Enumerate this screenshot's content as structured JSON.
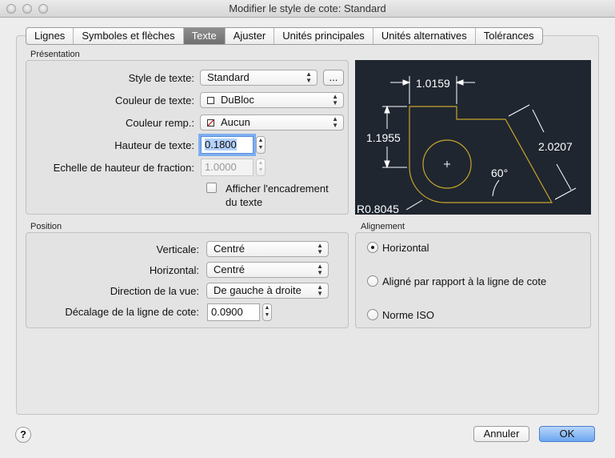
{
  "window": {
    "title": "Modifier le style de cote: Standard"
  },
  "tabs": [
    {
      "label": "Lignes"
    },
    {
      "label": "Symboles et flèches"
    },
    {
      "label": "Texte"
    },
    {
      "label": "Ajuster"
    },
    {
      "label": "Unités principales"
    },
    {
      "label": "Unités alternatives"
    },
    {
      "label": "Tolérances"
    }
  ],
  "active_tab": "Texte",
  "presentation": {
    "title": "Présentation",
    "text_style_label": "Style de texte:",
    "text_style_value": "Standard",
    "browse_label": "...",
    "text_color_label": "Couleur de texte:",
    "text_color_value": "DuBloc",
    "fill_color_label": "Couleur remp.:",
    "fill_color_value": "Aucun",
    "text_height_label": "Hauteur de texte:",
    "text_height_value": "0.1800",
    "fraction_scale_label": "Echelle de hauteur de fraction:",
    "fraction_scale_value": "1.0000",
    "frame_label_line1": "Afficher l'encadrement",
    "frame_label_line2": "du texte"
  },
  "preview": {
    "dim_top": "1.0159",
    "dim_left": "1.1955",
    "dim_diag": "2.0207",
    "angle": "60°",
    "radius": "R0.8045",
    "colors": {
      "background": "#1f2630",
      "geometry": "#c8a52a",
      "dimension": "#ffffff"
    }
  },
  "position": {
    "title": "Position",
    "vertical_label": "Verticale:",
    "vertical_value": "Centré",
    "horizontal_label": "Horizontal:",
    "horizontal_value": "Centré",
    "view_direction_label": "Direction de la vue:",
    "view_direction_value": "De gauche à droite",
    "offset_label": "Décalage de la ligne de cote:",
    "offset_value": "0.0900"
  },
  "alignment": {
    "title": "Alignement",
    "options": [
      {
        "label": "Horizontal",
        "checked": true
      },
      {
        "label": "Aligné par rapport à la ligne de cote",
        "checked": false
      },
      {
        "label": "Norme ISO",
        "checked": false
      }
    ]
  },
  "footer": {
    "help_label": "?",
    "cancel_label": "Annuler",
    "ok_label": "OK"
  }
}
